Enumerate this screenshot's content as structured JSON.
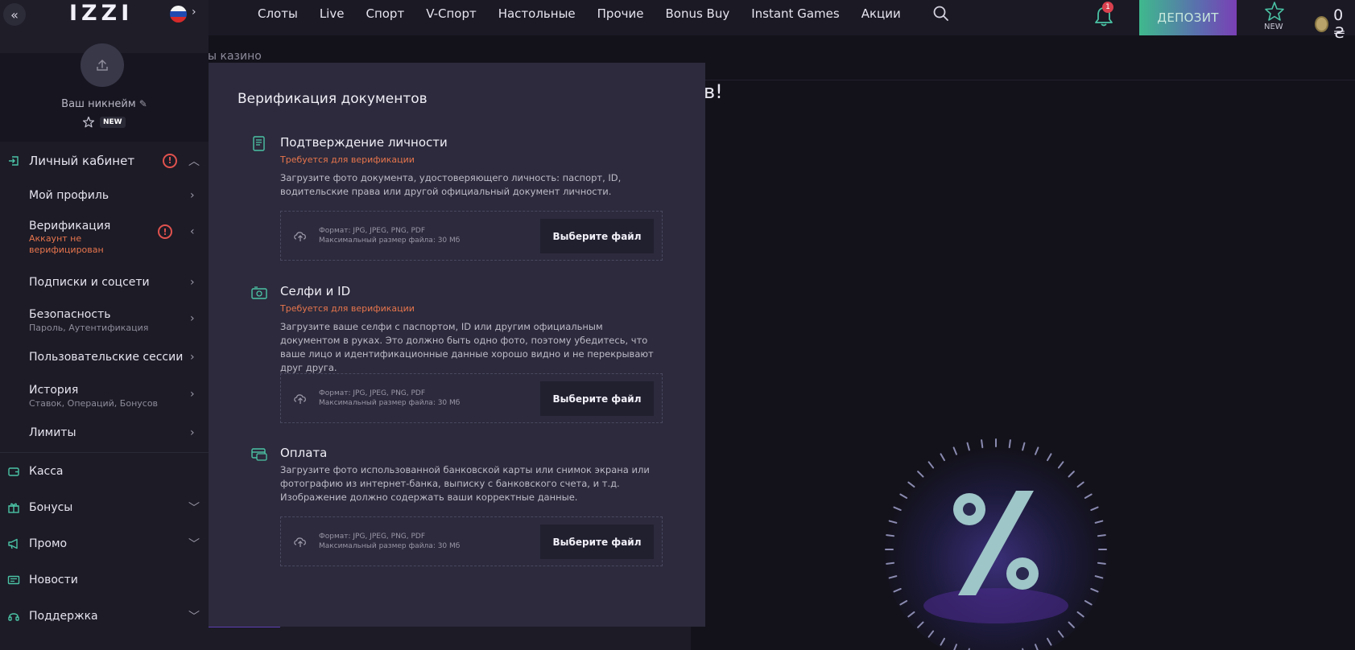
{
  "topbar": {
    "nav": [
      "Слоты",
      "Live",
      "Спорт",
      "V-Спорт",
      "Настольные",
      "Прочие",
      "Bonus Buy",
      "Instant Games",
      "Акции"
    ],
    "notifications_count": "1",
    "deposit_label": "ДЕПОЗИТ",
    "new_label": "NEW",
    "balance": "0 ₴"
  },
  "background": {
    "breadcrumb": "ы казино",
    "title_fragment": "в!"
  },
  "sidebar": {
    "logo": "IZZI",
    "collapse_glyph": "«",
    "nickname": "Ваш никнейм",
    "badge": "NEW",
    "account_section": "Личный кабинет",
    "items": [
      {
        "label": "Мой профиль",
        "sub": ""
      },
      {
        "label": "Верификация",
        "sub": "Аккаунт не",
        "sub2": "верифицирован"
      },
      {
        "label": "Подписки и соцсети",
        "sub": ""
      },
      {
        "label": "Безопасность",
        "sub": "Пароль, Аутентификация"
      },
      {
        "label": "Пользовательские сессии",
        "sub": ""
      },
      {
        "label": "История",
        "sub": "Ставок, Операций, Бонусов"
      },
      {
        "label": "Лимиты",
        "sub": ""
      }
    ],
    "main_items": [
      "Касса",
      "Бонусы",
      "Промо",
      "Новости",
      "Поддержка"
    ]
  },
  "modal": {
    "title": "Верификация документов",
    "choose_label": "Выберите файл",
    "format_text": "Формат: JPG, JPEG, PNG, PDF",
    "max_text": "Максимальный размер файла: 30 Мб",
    "sections": [
      {
        "title": "Подтверждение личности",
        "required": "Требуется для верификации",
        "desc": "Загрузите фото документа, удостоверяющего личность: паспорт, ID, водительские права или другой официальный документ личности."
      },
      {
        "title": "Селфи и ID",
        "required": "Требуется для верификации",
        "desc": "Загрузите ваше селфи с паспортом, ID или другим официальным документом в руках. Это должно быть одно фото, поэтому убедитесь, что ваше лицо и идентификационные данные хорошо видно и не перекрывают друг друга."
      },
      {
        "title": "Оплата",
        "required": "",
        "desc": "Загрузите фото использованной банковской карты или снимок экрана или фотографию из интернет-банка, выписку с банковского счета, и т.д. Изображение должно содержать ваши корректные данные."
      }
    ]
  },
  "colors": {
    "accent_warning": "#e0524e",
    "required_text": "#e8754d",
    "modal_bg": "#2c2a3c",
    "sidebar_bg": "#1c1b26"
  }
}
